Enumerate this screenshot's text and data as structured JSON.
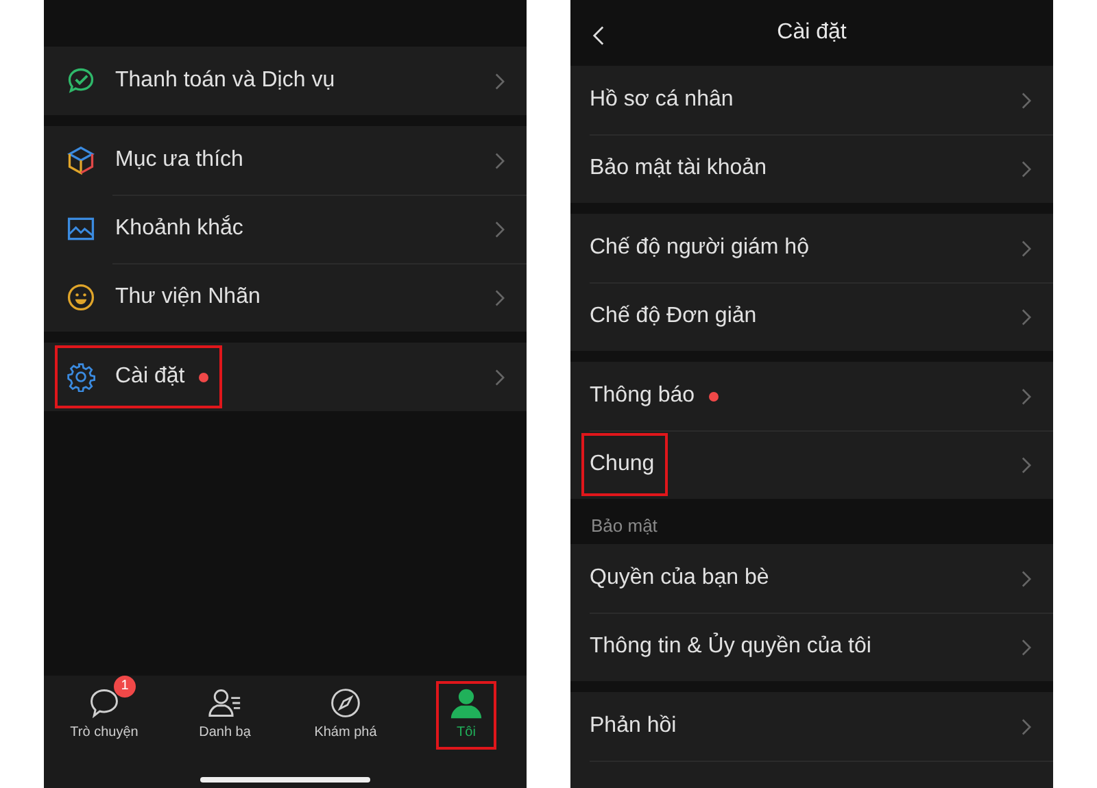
{
  "left_screen": {
    "groups": [
      [
        {
          "label": "Thanh toán và Dịch vụ",
          "dot": false,
          "highlighted": false
        }
      ],
      [
        {
          "label": "Mục ưa thích",
          "dot": false,
          "highlighted": false
        },
        {
          "label": "Khoảnh khắc",
          "dot": false,
          "highlighted": false
        },
        {
          "label": "Thư viện Nhãn",
          "dot": false,
          "highlighted": false
        }
      ],
      [
        {
          "label": "Cài đặt",
          "dot": true,
          "highlighted": true
        }
      ]
    ],
    "tabs": [
      {
        "label": "Trò chuyện",
        "badge": "1",
        "selected": false,
        "highlighted": false
      },
      {
        "label": "Danh bạ",
        "selected": false,
        "highlighted": false
      },
      {
        "label": "Khám phá",
        "selected": false,
        "highlighted": false
      },
      {
        "label": "Tôi",
        "selected": true,
        "highlighted": true
      }
    ]
  },
  "right_screen": {
    "title": "Cài đặt",
    "sections": [
      {
        "items": [
          {
            "label": "Hồ sơ cá nhân",
            "dot": false,
            "highlighted": false
          },
          {
            "label": "Bảo mật tài khoản",
            "dot": false,
            "highlighted": false
          }
        ]
      },
      {
        "items": [
          {
            "label": "Chế độ người giám hộ",
            "dot": false,
            "highlighted": false
          },
          {
            "label": "Chế độ Đơn giản",
            "dot": false,
            "highlighted": false
          }
        ]
      },
      {
        "items": [
          {
            "label": "Thông báo",
            "dot": true,
            "highlighted": false
          },
          {
            "label": "Chung",
            "dot": false,
            "highlighted": true
          }
        ]
      },
      {
        "header": "Bảo mật",
        "items": [
          {
            "label": "Quyền của bạn bè",
            "dot": false,
            "highlighted": false
          },
          {
            "label": "Thông tin & Ủy quyền của tôi",
            "dot": false,
            "highlighted": false
          }
        ]
      },
      {
        "items": [
          {
            "label": "Phản hồi",
            "dot": false,
            "highlighted": false
          }
        ]
      }
    ]
  }
}
